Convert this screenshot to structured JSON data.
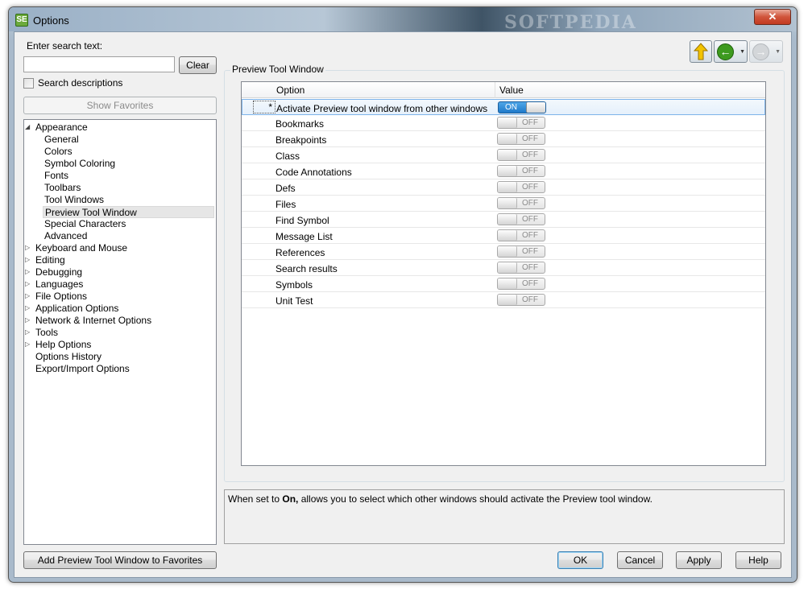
{
  "window": {
    "title": "Options",
    "app_icon_text": "SE",
    "close_label": "✕",
    "watermark": "SOFTPEDIA"
  },
  "search": {
    "label": "Enter search text:",
    "value": "",
    "placeholder": "",
    "clear_label": "Clear",
    "descriptions_label": "Search descriptions"
  },
  "favorites": {
    "show_label": "Show Favorites",
    "add_label": "Add Preview Tool Window to Favorites"
  },
  "tree": {
    "items": [
      {
        "label": "Appearance",
        "level": 0,
        "arrow": "expanded"
      },
      {
        "label": "General",
        "level": 1
      },
      {
        "label": "Colors",
        "level": 1
      },
      {
        "label": "Symbol Coloring",
        "level": 1
      },
      {
        "label": "Fonts",
        "level": 1
      },
      {
        "label": "Toolbars",
        "level": 1
      },
      {
        "label": "Tool Windows",
        "level": 1
      },
      {
        "label": "Preview Tool Window",
        "level": 1,
        "selected": true
      },
      {
        "label": "Special Characters",
        "level": 1
      },
      {
        "label": "Advanced",
        "level": 1
      },
      {
        "label": "Keyboard and Mouse",
        "level": 0,
        "arrow": "collapsed"
      },
      {
        "label": "Editing",
        "level": 0,
        "arrow": "collapsed"
      },
      {
        "label": "Debugging",
        "level": 0,
        "arrow": "collapsed"
      },
      {
        "label": "Languages",
        "level": 0,
        "arrow": "collapsed"
      },
      {
        "label": "File Options",
        "level": 0,
        "arrow": "collapsed"
      },
      {
        "label": "Application Options",
        "level": 0,
        "arrow": "collapsed"
      },
      {
        "label": "Network & Internet Options",
        "level": 0,
        "arrow": "collapsed"
      },
      {
        "label": "Tools",
        "level": 0,
        "arrow": "collapsed"
      },
      {
        "label": "Help Options",
        "level": 0,
        "arrow": "collapsed"
      },
      {
        "label": "Options History",
        "level": 0
      },
      {
        "label": "Export/Import Options",
        "level": 0
      }
    ]
  },
  "panel": {
    "group_title": "Preview Tool Window",
    "columns": [
      "Option",
      "Value"
    ],
    "rows": [
      {
        "name": "Activate Preview tool window from other windows",
        "value": "ON",
        "marker": "*"
      },
      {
        "name": "Bookmarks",
        "value": "OFF"
      },
      {
        "name": "Breakpoints",
        "value": "OFF"
      },
      {
        "name": "Class",
        "value": "OFF"
      },
      {
        "name": "Code Annotations",
        "value": "OFF"
      },
      {
        "name": "Defs",
        "value": "OFF"
      },
      {
        "name": "Files",
        "value": "OFF"
      },
      {
        "name": "Find Symbol",
        "value": "OFF"
      },
      {
        "name": "Message List",
        "value": "OFF"
      },
      {
        "name": "References",
        "value": "OFF"
      },
      {
        "name": "Search results",
        "value": "OFF"
      },
      {
        "name": "Symbols",
        "value": "OFF"
      },
      {
        "name": "Unit Test",
        "value": "OFF"
      }
    ]
  },
  "description": {
    "before": "When set to ",
    "bold": "On,",
    "after": " allows you to select which other windows should activate the Preview tool window."
  },
  "buttons": {
    "ok": "OK",
    "cancel": "Cancel",
    "apply": "Apply",
    "help": "Help"
  },
  "nav": {
    "up_icon": "up-arrow-icon",
    "back_icon": "back-arrow-icon",
    "forward_icon": "forward-arrow-icon"
  },
  "colors": {
    "accent_blue": "#1f79c9",
    "nav_green": "#3d9a1f",
    "nav_yellow": "#f2c300"
  }
}
